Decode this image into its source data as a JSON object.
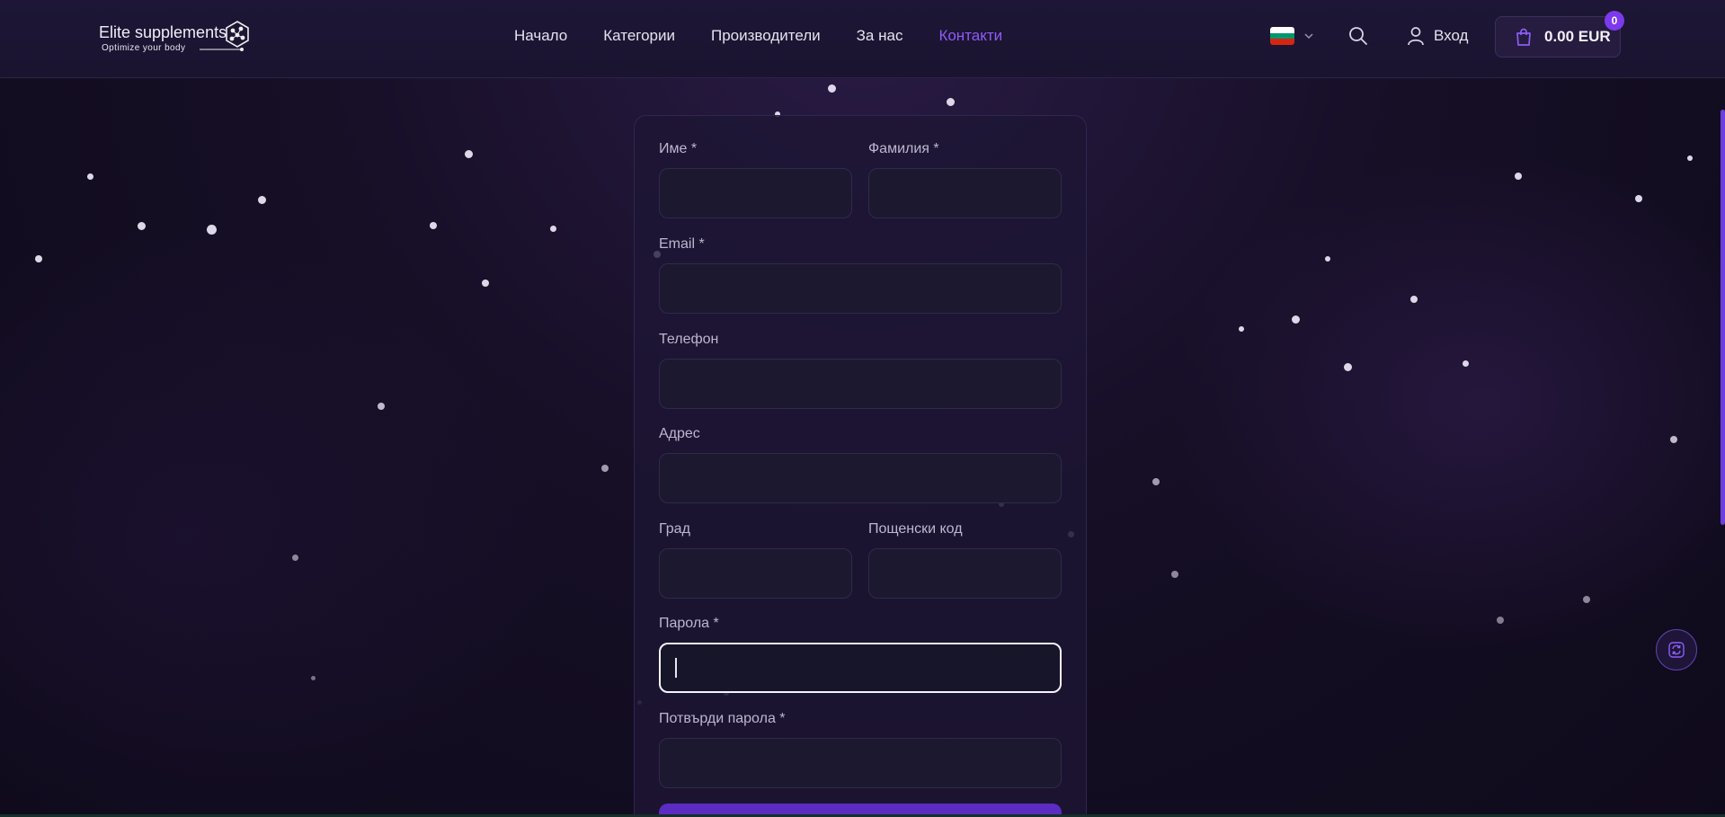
{
  "header": {
    "logo_main": "Elite supplements",
    "logo_sub": "Optimize your body",
    "nav": [
      {
        "label": "Начало"
      },
      {
        "label": "Категории"
      },
      {
        "label": "Производители"
      },
      {
        "label": "За нас"
      },
      {
        "label": "Контакти",
        "active": true
      }
    ],
    "language_flag": "bulgaria-flag",
    "login_label": "Вход",
    "cart_amount": "0.00 EUR",
    "cart_count": "0"
  },
  "form": {
    "first_name": {
      "label": "Име *",
      "value": ""
    },
    "last_name": {
      "label": "Фамилия *",
      "value": ""
    },
    "email": {
      "label": "Email *",
      "value": ""
    },
    "phone": {
      "label": "Телефон",
      "value": ""
    },
    "address": {
      "label": "Адрес",
      "value": ""
    },
    "city": {
      "label": "Град",
      "value": ""
    },
    "postal_code": {
      "label": "Пощенски код",
      "value": ""
    },
    "password": {
      "label": "Парола *",
      "value": "",
      "focused": true
    },
    "confirm_password": {
      "label": "Потвърди парола *",
      "value": ""
    }
  },
  "colors": {
    "accent": "#8d5cf6",
    "badge": "#7c3aed",
    "button": "#5b2bc2",
    "background": "#160f26"
  },
  "icons": {
    "search": "search-icon",
    "user": "user-icon",
    "cart": "shopping-bag-icon",
    "refresh": "refresh-icon",
    "chevron": "chevron-down-icon"
  }
}
